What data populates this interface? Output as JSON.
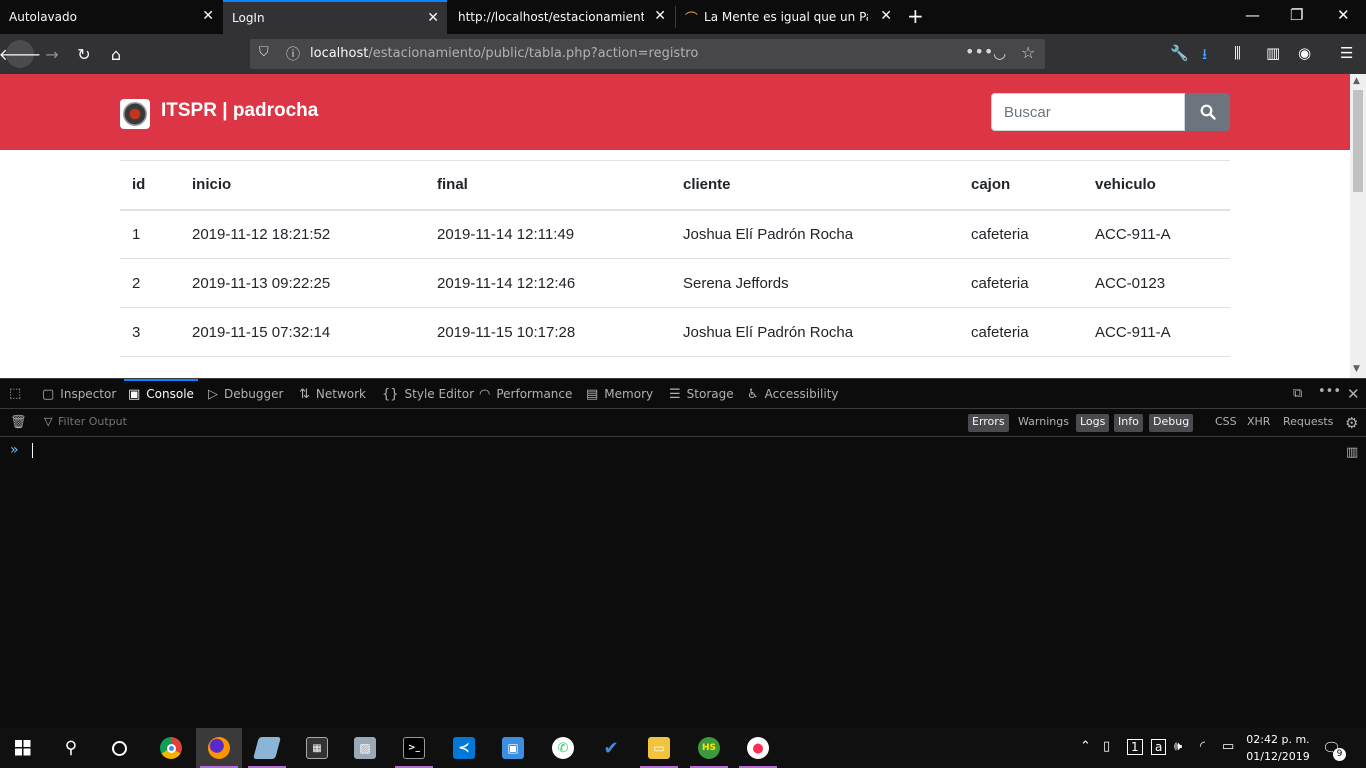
{
  "browser": {
    "tabs": [
      {
        "label": "Autolavado"
      },
      {
        "label": "LogIn"
      },
      {
        "label": "http://localhost/estacionamiento/p"
      },
      {
        "label": "La Mente es igual que un Parac"
      }
    ],
    "url_host": "localhost",
    "url_path": "/estacionamiento/public/tabla.php?action=registro"
  },
  "page": {
    "brand": "ITSPR | padrocha",
    "search_placeholder": "Buscar",
    "table": {
      "headers": [
        "id",
        "inicio",
        "final",
        "cliente",
        "cajon",
        "vehiculo"
      ],
      "rows": [
        [
          "1",
          "2019-11-12 18:21:52",
          "2019-11-14 12:11:49",
          "Joshua Elí Padrón Rocha",
          "cafeteria",
          "ACC-911-A"
        ],
        [
          "2",
          "2019-11-13 09:22:25",
          "2019-11-14 12:12:46",
          "Serena Jeffords",
          "cafeteria",
          "ACC-0123"
        ],
        [
          "3",
          "2019-11-15 07:32:14",
          "2019-11-15 10:17:28",
          "Joshua Elí Padrón Rocha",
          "cafeteria",
          "ACC-911-A"
        ]
      ]
    },
    "colors": {
      "header": "#dc3545",
      "search_button": "#6c757d"
    }
  },
  "devtools": {
    "tabs": [
      "Inspector",
      "Console",
      "Debugger",
      "Network",
      "Style Editor",
      "Performance",
      "Memory",
      "Storage",
      "Accessibility"
    ],
    "active_tab": "Console",
    "filter_placeholder": "Filter Output",
    "filters": [
      "Errors",
      "Warnings",
      "Logs",
      "Info",
      "Debug",
      "CSS",
      "XHR",
      "Requests"
    ]
  },
  "taskbar": {
    "time": "02:42 p. m.",
    "date": "01/12/2019",
    "notification_count": "9"
  }
}
